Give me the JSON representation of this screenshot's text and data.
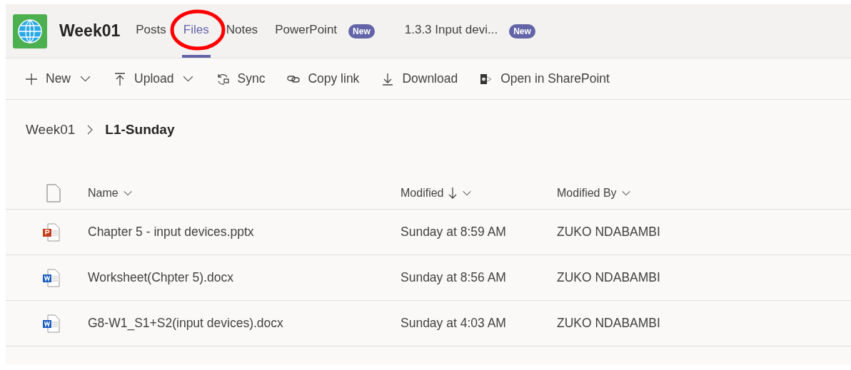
{
  "header": {
    "title": "Week01",
    "tabs": [
      {
        "label": "Posts",
        "selected": false
      },
      {
        "label": "Files",
        "selected": true,
        "annotated": true
      },
      {
        "label": "Notes",
        "selected": false
      },
      {
        "label": "PowerPoint",
        "selected": false,
        "badge": "New"
      },
      {
        "label": "1.3.3 Input devi...",
        "selected": false,
        "badge": "New"
      }
    ]
  },
  "toolbar": [
    {
      "kind": "plus",
      "label": "New",
      "dropdown": true
    },
    {
      "kind": "upload",
      "label": "Upload",
      "dropdown": true
    },
    {
      "kind": "sync",
      "label": "Sync",
      "dropdown": false
    },
    {
      "kind": "link",
      "label": "Copy link",
      "dropdown": false
    },
    {
      "kind": "download",
      "label": "Download",
      "dropdown": false
    },
    {
      "kind": "sharepoint",
      "label": "Open in SharePoint",
      "dropdown": false
    }
  ],
  "breadcrumb": [
    "Week01",
    "L1-Sunday"
  ],
  "table": {
    "columns": [
      {
        "label": "Name",
        "sorted": false
      },
      {
        "label": "Modified",
        "sorted": true
      },
      {
        "label": "Modified By",
        "sorted": false
      }
    ],
    "rows": [
      {
        "kind": "powerpoint",
        "name": "Chapter 5 - input devices.pptx",
        "modified": "Sunday at 8:59 AM",
        "modified_by": "ZUKO NDABAMBI"
      },
      {
        "kind": "word",
        "name": "Worksheet(Chpter 5).docx",
        "modified": "Sunday at 8:56 AM",
        "modified_by": "ZUKO NDABAMBI"
      },
      {
        "kind": "word",
        "name": "G8-W1_S1+S2(input devices).docx",
        "modified": "Sunday at 4:03 AM",
        "modified_by": "ZUKO NDABAMBI"
      }
    ]
  }
}
